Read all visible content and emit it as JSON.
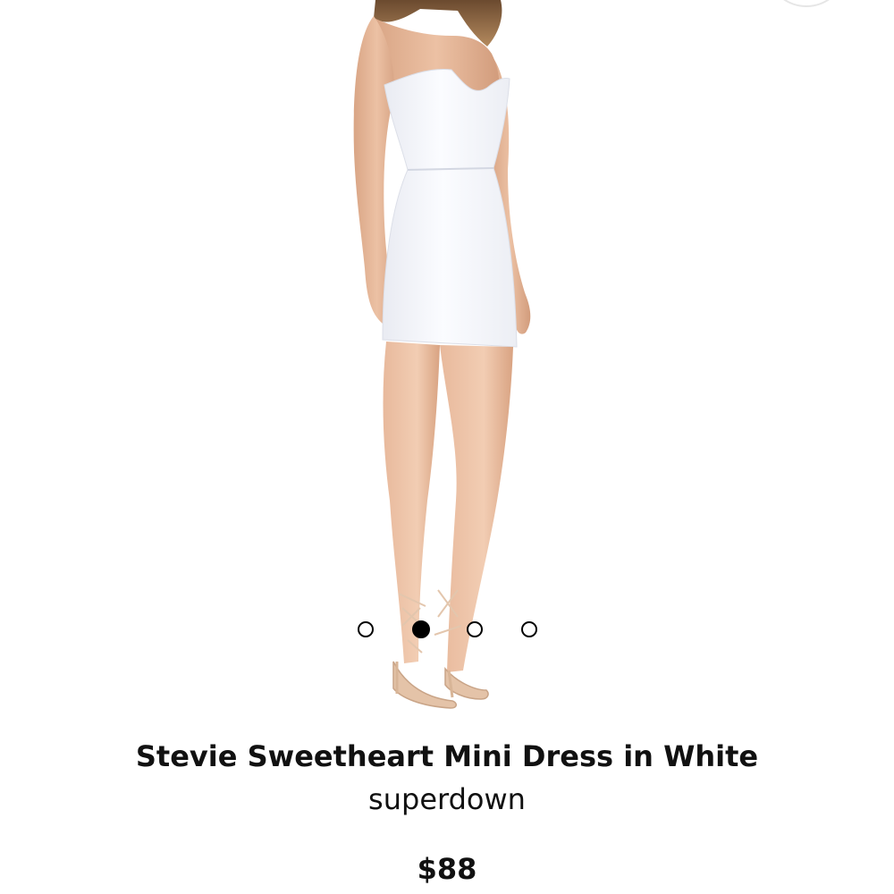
{
  "product": {
    "title": "Stevie Sweetheart Mini Dress in White",
    "brand": "superdown",
    "price": "$88"
  },
  "gallery": {
    "image_count": 4,
    "active_index": 2,
    "image_subject": "model wearing white strapless mini dress and nude lace-up heels"
  },
  "colors": {
    "text": "#111111",
    "background": "#ffffff",
    "dress": "#f7f8fb",
    "skin": "#e2b294",
    "active_dot": "#000000"
  }
}
